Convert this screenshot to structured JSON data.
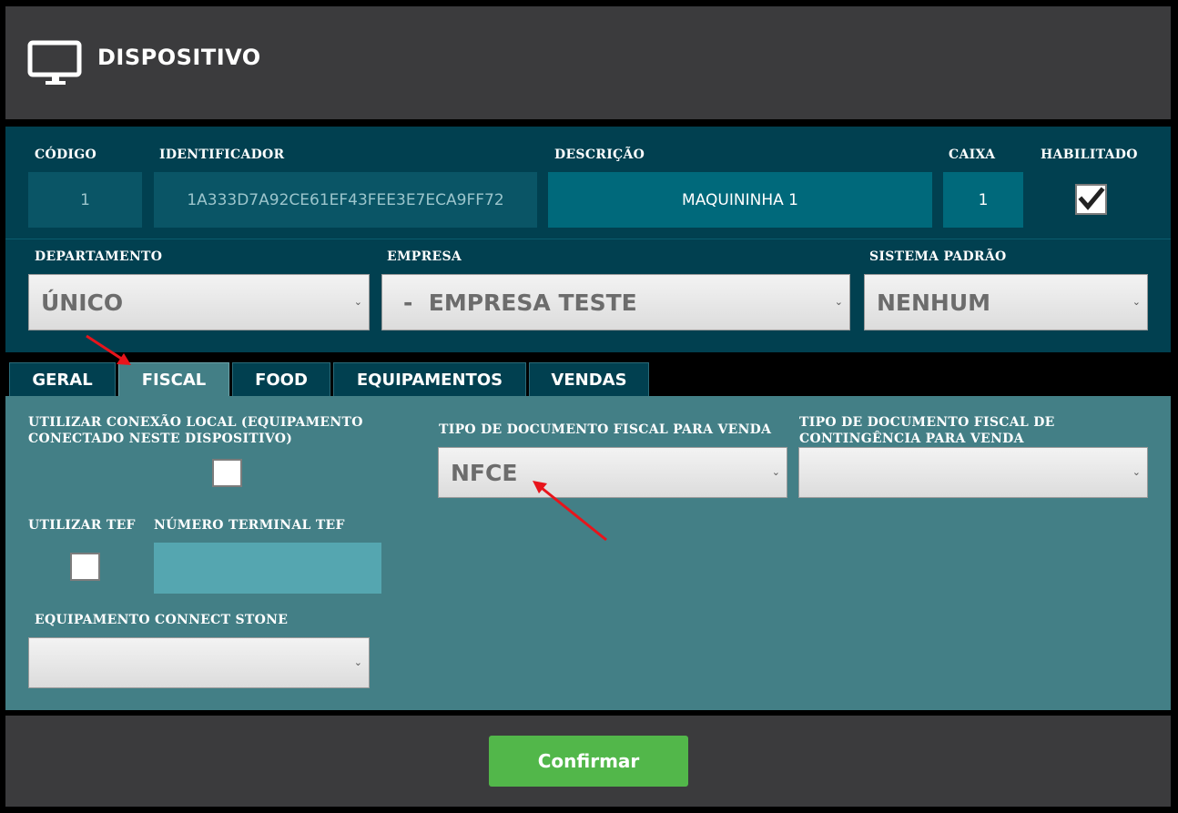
{
  "header": {
    "title": "DISPOSITIVO",
    "icon": "monitor-icon"
  },
  "device": {
    "labels": {
      "codigo": "CÓDIGO",
      "identificador": "IDENTIFICADOR",
      "descricao": "DESCRIÇÃO",
      "caixa": "CAIXA",
      "habilitado": "HABILITADO",
      "departamento": "DEPARTAMENTO",
      "empresa": "EMPRESA",
      "sistema_padrao": "SISTEMA PADRÃO"
    },
    "values": {
      "codigo": "1",
      "identificador": "1A333D7A92CE61EF43FEE3E7ECA9FF72",
      "descricao": "MAQUININHA 1",
      "caixa": "1",
      "habilitado": true,
      "departamento": "ÚNICO",
      "empresa": "-  EMPRESA TESTE",
      "sistema_padrao": "NENHUM"
    }
  },
  "tabs": [
    {
      "label": "GERAL",
      "active": false
    },
    {
      "label": "FISCAL",
      "active": true
    },
    {
      "label": "FOOD",
      "active": false
    },
    {
      "label": "EQUIPAMENTOS",
      "active": false
    },
    {
      "label": "VENDAS",
      "active": false
    }
  ],
  "fiscal": {
    "conexao_local_label": "UTILIZAR CONEXÃO LOCAL (EQUIPAMENTO CONECTADO NESTE DISPOSITIVO)",
    "conexao_local_checked": false,
    "tipo_doc_label": "TIPO DE DOCUMENTO FISCAL PARA VENDA",
    "tipo_doc_value": "NFCE",
    "tipo_doc_contingencia_label": "TIPO DE DOCUMENTO FISCAL DE CONTINGÊNCIA PARA VENDA",
    "tipo_doc_contingencia_value": "",
    "utilizar_tef_label": "UTILIZAR TEF",
    "utilizar_tef_checked": false,
    "numero_terminal_tef_label": "NÚMERO TERMINAL TEF",
    "numero_terminal_tef_value": "",
    "equipamento_connect_stone_label": "EQUIPAMENTO CONNECT STONE",
    "equipamento_connect_stone_value": ""
  },
  "footer": {
    "confirm_label": "Confirmar"
  },
  "colors": {
    "header_bg": "#3b3b3d",
    "panel_bg": "#014050",
    "content_bg": "#437f86",
    "confirm_green": "#52b74a",
    "annotation_arrow": "#e8141b"
  }
}
